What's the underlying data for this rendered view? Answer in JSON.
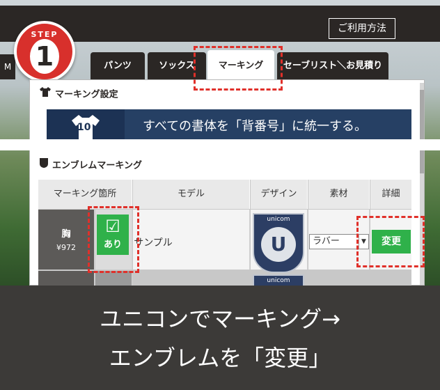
{
  "header": {
    "help_label": "ご利用方法"
  },
  "step": {
    "label": "STEP",
    "number": "1"
  },
  "side_tab": {
    "label": "M"
  },
  "tabs": [
    {
      "label": "パンツ"
    },
    {
      "label": "ソックス"
    },
    {
      "label": "マーキング",
      "active": true
    },
    {
      "label": "セーブリスト＼お見積り"
    }
  ],
  "marking_settings": {
    "title": "マーキング設定",
    "banner_text": "すべての書体を「背番号」に統一する。",
    "banner_number": "10"
  },
  "emblem_section": {
    "title": "エンブレムマーキング",
    "columns": [
      "マーキング箇所",
      "モデル",
      "デザイン",
      "素材",
      "詳細"
    ],
    "row": {
      "location": "胸",
      "price": "¥972",
      "checkbox_mark": "☑",
      "checkbox_label": "あり",
      "model": "サンプル",
      "emblem_brand": "unicom",
      "emblem_letter": "U",
      "material": "ラバー",
      "change_label": "変更"
    }
  },
  "caption": {
    "line1": "ユニコンでマーキング→",
    "line2": "エンブレムを「変更」"
  },
  "colors": {
    "accent_red": "#e0302a",
    "green": "#2fb14a",
    "navy": "#264064",
    "dark": "#2b2725"
  }
}
